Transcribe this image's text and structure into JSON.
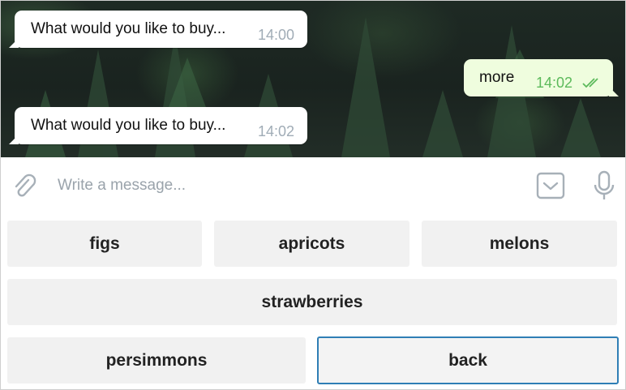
{
  "messages": [
    {
      "direction": "incoming",
      "text": "What would you like to buy...",
      "time": "14:00"
    },
    {
      "direction": "outgoing",
      "text": "more",
      "time": "14:02",
      "status_icon": "double-check-icon"
    },
    {
      "direction": "incoming",
      "text": "What would you like to buy...",
      "time": "14:02"
    }
  ],
  "composer": {
    "placeholder": "Write a message...",
    "icons": [
      "paperclip-icon",
      "keyboard-toggle-icon",
      "microphone-icon"
    ]
  },
  "keyboard": {
    "rows": [
      [
        "figs",
        "apricots",
        "melons"
      ],
      [
        "strawberries"
      ],
      [
        "persimmons",
        "back"
      ]
    ],
    "focused_button": "back"
  },
  "colors": {
    "accent": "#2f7eb5",
    "outgoing_bubble": "#effdde",
    "outgoing_time": "#5cba5b",
    "incoming_time": "#a0acb6",
    "button_bg": "#f1f1f1"
  }
}
